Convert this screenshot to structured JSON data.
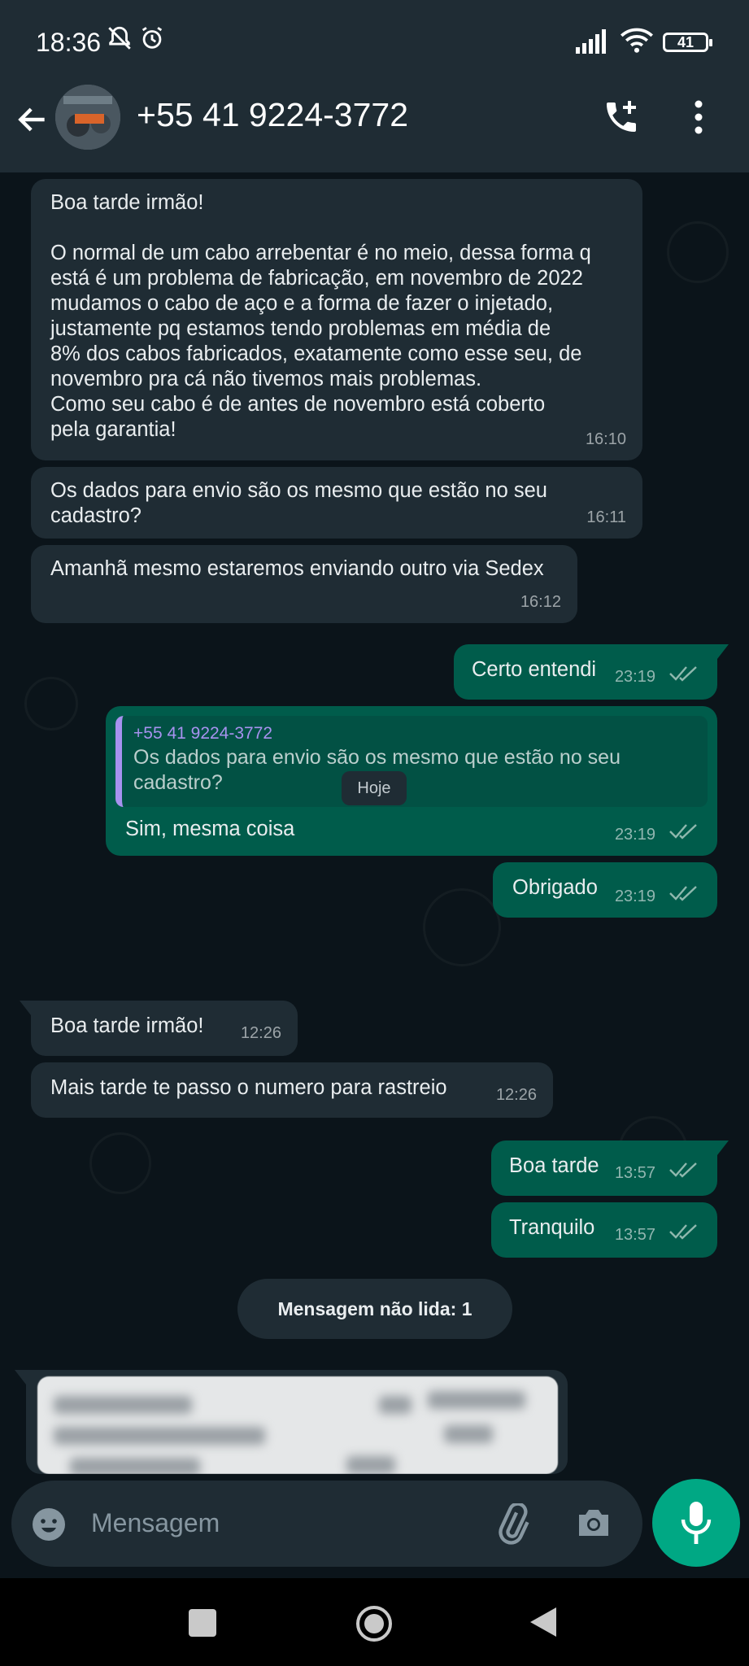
{
  "status_bar": {
    "time": "18:36",
    "battery": "41"
  },
  "header": {
    "contact_name": "+55 41 9224-3772"
  },
  "messages": [
    {
      "direction": "in",
      "text": "Boa tarde irmão!\n\nO normal de um cabo arrebentar é no meio, dessa forma q\nestá é um problema de fabricação, em novembro de 2022\nmudamos o cabo de aço e a forma de fazer o injetado,\njustamente pq estamos tendo problemas em média de\n8% dos cabos fabricados, exatamente como esse seu, de\nnovembro pra cá não tivemos mais problemas.\nComo seu cabo é de antes de novembro está coberto\npela garantia!",
      "time": "16:10"
    },
    {
      "direction": "in",
      "text": "Os dados para envio são os mesmo que estão no seu\ncadastro?",
      "time": "16:11"
    },
    {
      "direction": "in",
      "text": "Amanhã mesmo estaremos enviando outro via Sedex",
      "time": "16:12"
    },
    {
      "direction": "out",
      "text": "Certo entendi",
      "time": "23:19"
    },
    {
      "direction": "out",
      "quote_author": "+55 41 9224-3772",
      "quote_text": "Os dados para envio são os mesmo que estão no seu\ncadastro?",
      "text": "Sim, mesma coisa",
      "time": "23:19"
    },
    {
      "direction": "out",
      "text": "Obrigado",
      "time": "23:19"
    },
    {
      "direction": "in",
      "text": "Boa tarde irmão!",
      "time": "12:26"
    },
    {
      "direction": "in",
      "text": "Mais tarde te passo o numero para rastreio",
      "time": "12:26"
    },
    {
      "direction": "out",
      "text": "Boa tarde",
      "time": "13:57"
    },
    {
      "direction": "out",
      "text": "Tranquilo",
      "time": "13:57"
    }
  ],
  "date_separator": "Hoje",
  "unread_label": "Mensagem não lida: 1",
  "input": {
    "placeholder": "Mensagem"
  },
  "colors": {
    "incoming_bubble": "#1f2c34",
    "outgoing_bubble": "#005c4b",
    "accent": "#00a884",
    "quote_author": "#a792ef"
  }
}
